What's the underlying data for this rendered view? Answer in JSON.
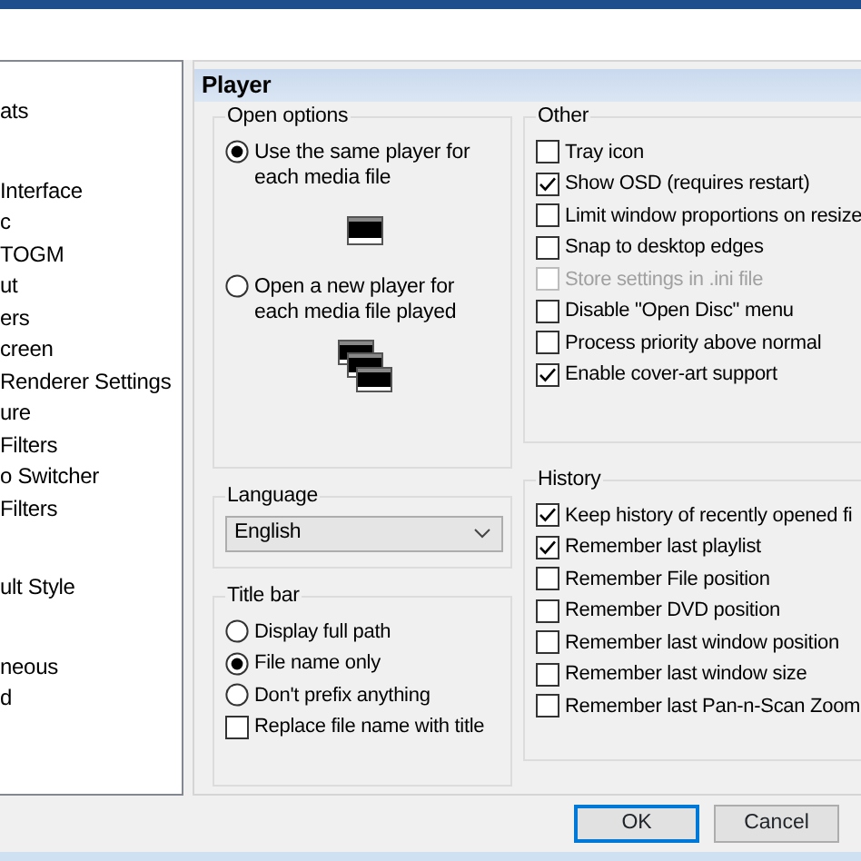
{
  "tree": {
    "groups": [
      {
        "items": [
          "ats"
        ]
      },
      {
        "items": [
          "Interface",
          "c",
          "TOGM",
          "ut",
          "ers",
          "creen",
          "Renderer Settings",
          "ure",
          "Filters",
          "o Switcher",
          "Filters"
        ]
      },
      {
        "items": [
          "ult Style"
        ]
      },
      {
        "items": [
          "neous",
          "d"
        ]
      }
    ]
  },
  "page_title": "Player",
  "open_options": {
    "title": "Open options",
    "options": [
      {
        "label": "Use the same player for each media file",
        "selected": true,
        "kind": "single"
      },
      {
        "label": "Open a new player for each media file played",
        "selected": false,
        "kind": "multiple"
      }
    ]
  },
  "language": {
    "title": "Language",
    "value": "English"
  },
  "title_bar": {
    "title": "Title bar",
    "options": [
      {
        "label": "Display full path",
        "selected": false
      },
      {
        "label": "File name only",
        "selected": true
      },
      {
        "label": "Don't prefix anything",
        "selected": false
      }
    ],
    "checkbox": {
      "label": "Replace file name with title",
      "checked": false
    }
  },
  "other": {
    "title": "Other",
    "items": [
      {
        "label": "Tray icon",
        "checked": false,
        "disabled": false
      },
      {
        "label": "Show OSD (requires restart)",
        "checked": true,
        "disabled": false
      },
      {
        "label": "Limit window proportions on resize",
        "checked": false,
        "disabled": false
      },
      {
        "label": "Snap to desktop edges",
        "checked": false,
        "disabled": false
      },
      {
        "label": "Store settings in .ini file",
        "checked": false,
        "disabled": true
      },
      {
        "label": "Disable \"Open Disc\" menu",
        "checked": false,
        "disabled": false
      },
      {
        "label": "Process priority above normal",
        "checked": false,
        "disabled": false
      },
      {
        "label": "Enable cover-art support",
        "checked": true,
        "disabled": false
      }
    ]
  },
  "history": {
    "title": "History",
    "items": [
      {
        "label": "Keep history of recently opened fi",
        "checked": true,
        "disabled": false
      },
      {
        "label": "Remember last playlist",
        "checked": true,
        "disabled": false
      },
      {
        "label": "Remember File position",
        "checked": false,
        "disabled": false
      },
      {
        "label": "Remember DVD position",
        "checked": false,
        "disabled": false
      },
      {
        "label": "Remember last window position",
        "checked": false,
        "disabled": false
      },
      {
        "label": "Remember last window size",
        "checked": false,
        "disabled": false
      },
      {
        "label": "Remember last Pan-n-Scan Zoom",
        "checked": false,
        "disabled": false
      }
    ]
  },
  "buttons": [
    {
      "label": "OK",
      "default": true
    },
    {
      "label": "Cancel",
      "default": false
    }
  ]
}
